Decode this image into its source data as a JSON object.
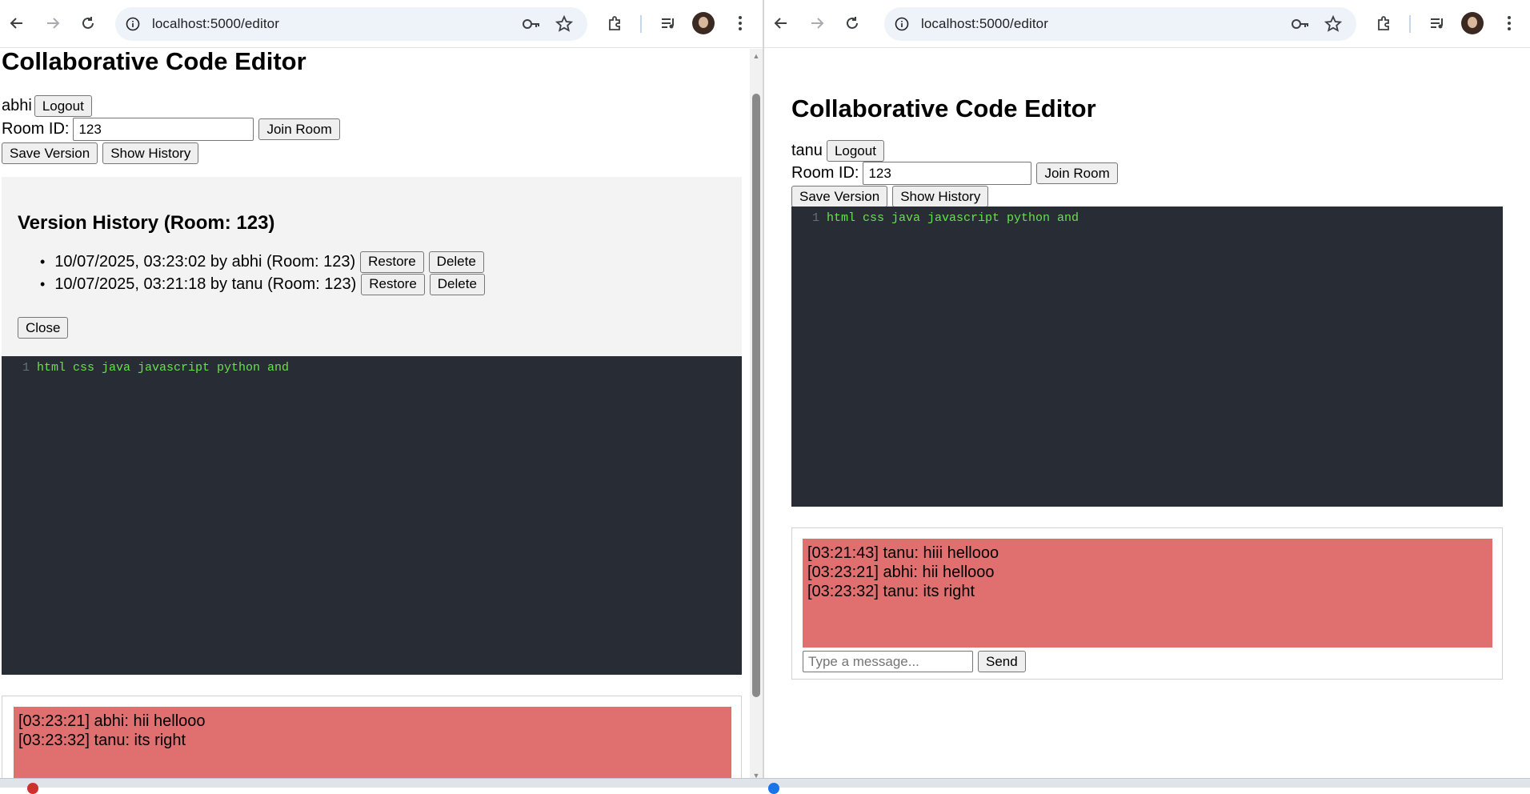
{
  "browser": {
    "url": "localhost:5000/editor"
  },
  "left": {
    "app_title": "Collaborative Code Editor",
    "username": "abhi",
    "logout_label": "Logout",
    "room_label": "Room ID:",
    "room_value": "123",
    "join_label": "Join Room",
    "save_label": "Save Version",
    "history_label": "Show History",
    "history_panel": {
      "heading": "Version History (Room: 123)",
      "items": [
        {
          "text": "10/07/2025, 03:23:02 by abhi (Room: 123)",
          "restore": "Restore",
          "delete": "Delete"
        },
        {
          "text": "10/07/2025, 03:21:18 by tanu (Room: 123)",
          "restore": "Restore",
          "delete": "Delete"
        }
      ],
      "close_label": "Close"
    },
    "editor": {
      "line_number": "1",
      "code": "html css java javascript python and"
    },
    "chat": {
      "messages": [
        "[03:23:21] abhi: hii hellooo",
        "[03:23:32] tanu: its right"
      ]
    }
  },
  "right": {
    "app_title": "Collaborative Code Editor",
    "username": "tanu",
    "logout_label": "Logout",
    "room_label": "Room ID:",
    "room_value": "123",
    "join_label": "Join Room",
    "save_label": "Save Version",
    "history_label": "Show History",
    "editor": {
      "line_number": "1",
      "code": "html css java javascript python and"
    },
    "chat": {
      "messages": [
        "[03:21:43] tanu: hiii hellooo",
        "[03:23:21] abhi: hii hellooo",
        "[03:23:32] tanu: its right"
      ],
      "input_placeholder": "Type a message...",
      "send_label": "Send"
    }
  },
  "colors": {
    "editor_bg": "#282c34",
    "code_text": "#69e04f",
    "chat_bg": "#e07070",
    "history_bg": "#f3f3f3"
  }
}
